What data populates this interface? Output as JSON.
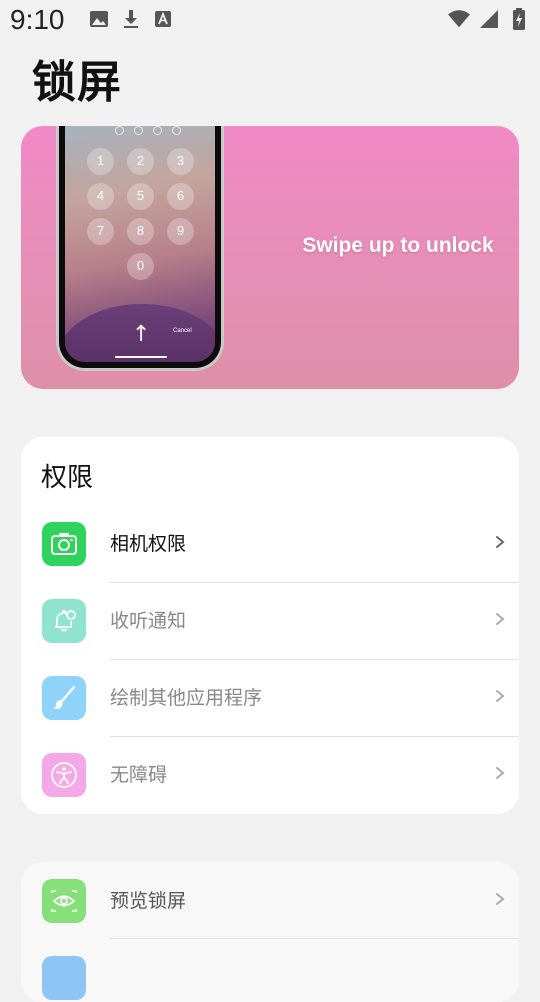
{
  "status_bar": {
    "time": "9:10",
    "left_icons": [
      "image-icon",
      "download-icon",
      "text-a-icon"
    ],
    "right_icons": [
      "wifi-icon",
      "cell-signal-icon",
      "battery-charging-icon"
    ]
  },
  "page": {
    "title": "锁屏"
  },
  "banner": {
    "text": "Swipe up to unlock",
    "phone": {
      "keys": [
        "1",
        "2",
        "3",
        "4",
        "5",
        "6",
        "7",
        "8",
        "9",
        "0"
      ],
      "cancel": "Cancel"
    }
  },
  "permissions": {
    "title": "权限",
    "items": [
      {
        "label": "相机权限",
        "icon": "camera-icon",
        "color": "#2fd35a",
        "enabled": true
      },
      {
        "label": "收听通知",
        "icon": "bell-icon",
        "color": "#8fe3cf",
        "enabled": false
      },
      {
        "label": "绘制其他应用程序",
        "icon": "brush-icon",
        "color": "#8fd3fb",
        "enabled": false
      },
      {
        "label": "无障碍",
        "icon": "accessibility-icon",
        "color": "#f4a8e8",
        "enabled": false
      }
    ]
  },
  "more": {
    "items": [
      {
        "label": "预览锁屏",
        "icon": "eye-icon",
        "color": "#86e07a"
      },
      {
        "label": "",
        "icon": "",
        "color": "#8ec5f5"
      }
    ]
  }
}
